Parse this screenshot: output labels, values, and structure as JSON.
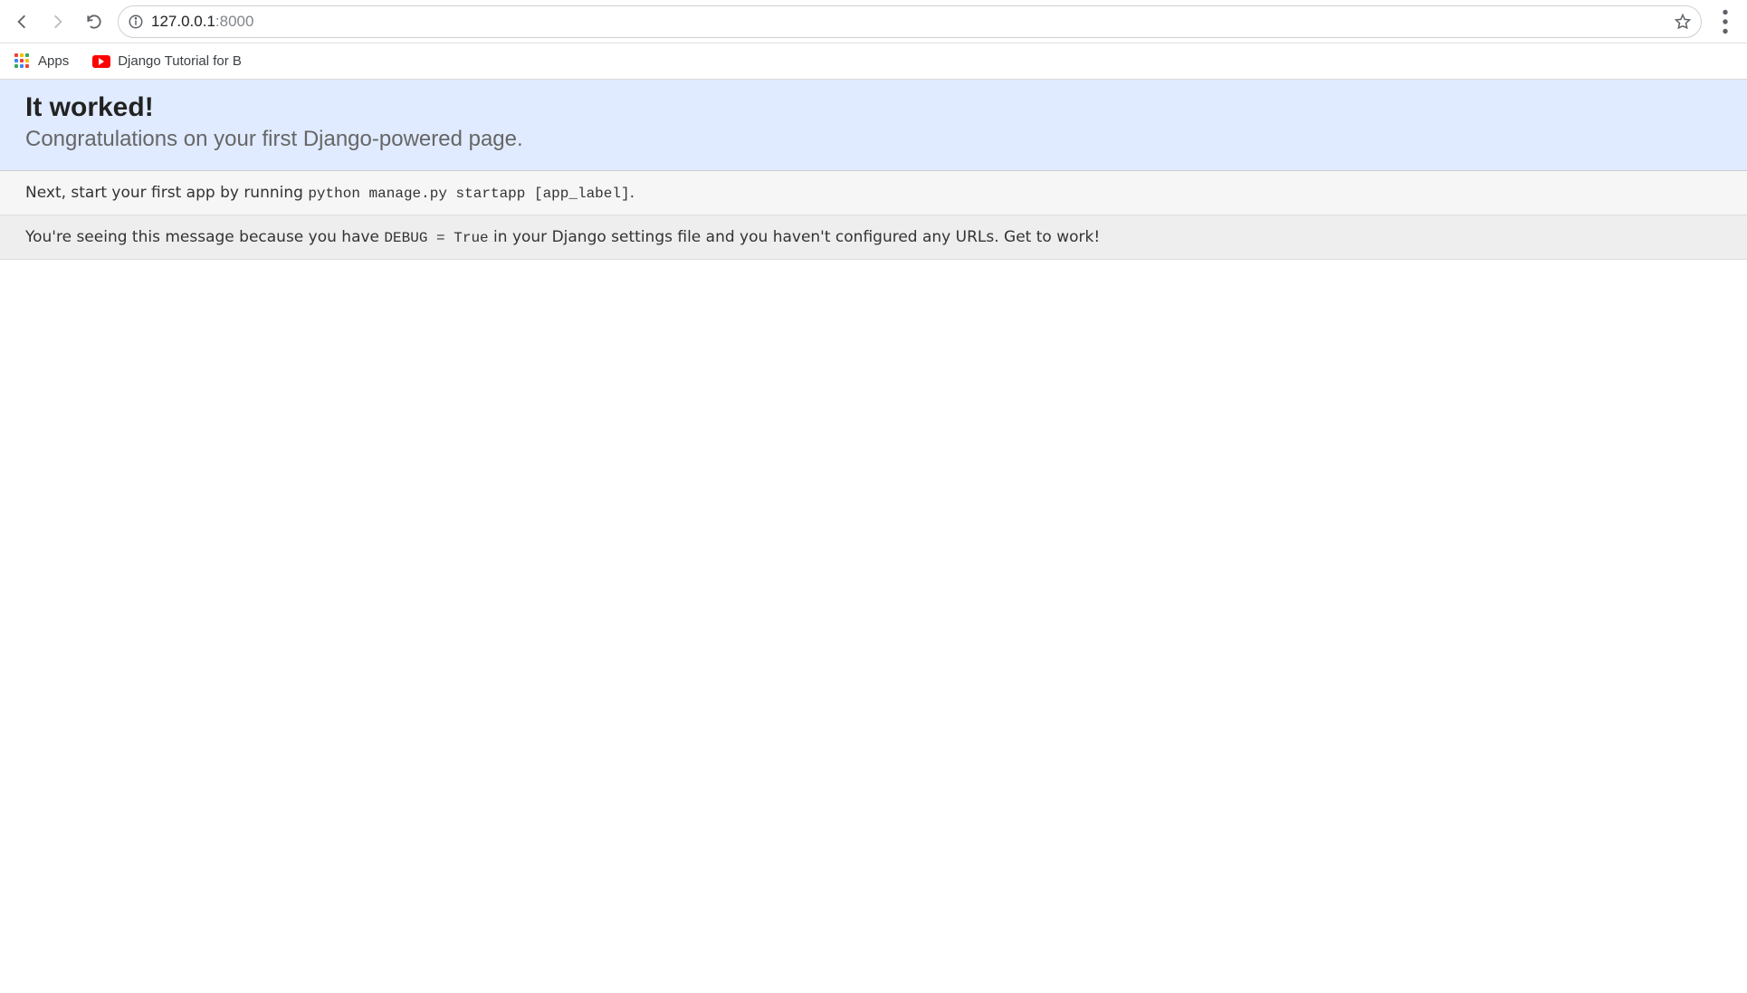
{
  "browser": {
    "url_host": "127.0.0.1",
    "url_port": ":8000",
    "bookmarks": {
      "apps_label": "Apps",
      "django_tutorial_label": "Django Tutorial for B"
    }
  },
  "page": {
    "summary": {
      "title": "It worked!",
      "subtitle": "Congratulations on your first Django-powered page."
    },
    "instructions": {
      "prefix": "Next, start your first app by running ",
      "code": "python manage.py startapp [app_label]",
      "suffix": "."
    },
    "explanation": {
      "prefix": "You're seeing this message because you have ",
      "code": "DEBUG = True",
      "suffix": " in your Django settings file and you haven't configured any URLs. Get to work!"
    }
  }
}
